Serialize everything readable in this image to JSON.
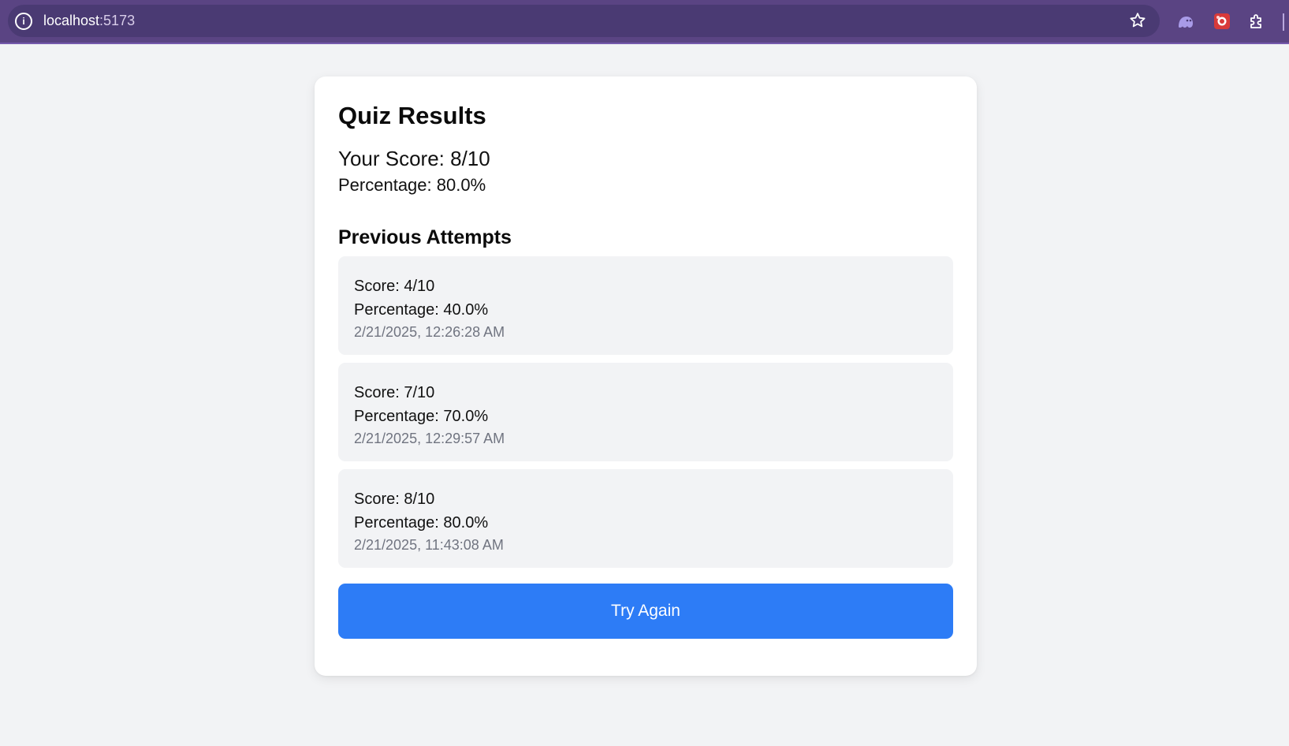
{
  "browser": {
    "url_host": "localhost",
    "url_port": ":5173",
    "icons": [
      "info-icon",
      "bookmark-star-icon",
      "ghost-extension-icon",
      "red-extension-icon",
      "puzzle-extensions-icon"
    ]
  },
  "results": {
    "title": "Quiz Results",
    "score_text": "Your Score: 8/10",
    "percentage_text": "Percentage: 80.0%"
  },
  "previous": {
    "title": "Previous Attempts",
    "attempts": [
      {
        "score": "Score: 4/10",
        "percentage": "Percentage: 40.0%",
        "date": "2/21/2025, 12:26:28 AM"
      },
      {
        "score": "Score: 7/10",
        "percentage": "Percentage: 70.0%",
        "date": "2/21/2025, 12:29:57 AM"
      },
      {
        "score": "Score: 8/10",
        "percentage": "Percentage: 80.0%",
        "date": "2/21/2025, 11:43:08 AM"
      }
    ]
  },
  "actions": {
    "try_again_label": "Try Again"
  },
  "colors": {
    "browser_bar": "#5a4483",
    "page_background": "#f2f3f5",
    "button_primary": "#2d7cf6",
    "date_text": "#707480"
  }
}
